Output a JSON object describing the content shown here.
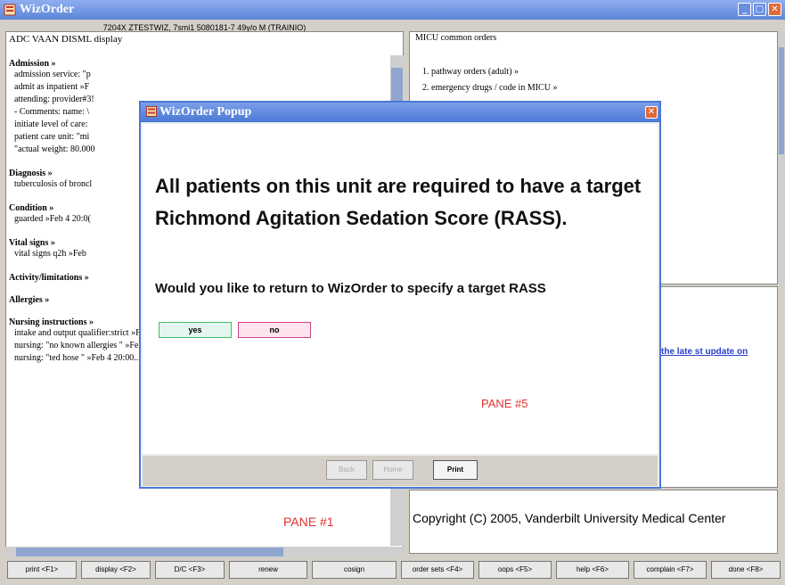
{
  "window": {
    "title": "WizOrder"
  },
  "left_pane": {
    "header": "7204X ZTESTWIZ, 7smi1 5080181-7 49y/o M (TRAINIO)",
    "title": "ADC VAAN DISML display",
    "sections": [
      {
        "head": "Admission »",
        "lines": [
          "admission service: \"p",
          "admit as inpatient »F",
          "attending: provider#3!",
          "- Comments: name: \\",
          "initiate level of care:",
          "patient care unit: \"mi",
          "\"actual weight: 80.000"
        ]
      },
      {
        "head": "Diagnosis »",
        "lines": [
          "tuberculosis of broncl"
        ]
      },
      {
        "head": "Condition »",
        "lines": [
          "guarded »Feb 4 20:0("
        ]
      },
      {
        "head": "Vital signs »",
        "lines": [
          "vital signs q2h »Feb"
        ]
      },
      {
        "head": "Activity/limitations »",
        "lines": []
      },
      {
        "head": "Allergies »",
        "lines": []
      },
      {
        "head": "Nursing instructions »",
        "lines": [
          "intake and output qualifier:strict »Feb 4 20:00...",
          "nursing: \"no known allergies \" »Feb 4 20:00...",
          "nursing: \"ted hose \" »Feb 4 20:00..."
        ]
      }
    ],
    "pane_label": "PANE #1"
  },
  "right_top": {
    "title": "MICU common orders",
    "items": [
      "1. pathway orders (adult) »",
      "2. emergency drugs / code in MICU »"
    ]
  },
  "right_mid": {
    "link": "the late st update on"
  },
  "right_bot": {
    "copyright": "Copyright (C) 2005, Vanderbilt University Medical Center"
  },
  "function_buttons": [
    "print <F1>",
    "display <F2>",
    "D/C <F3>",
    "renew",
    "cosign",
    "order sets <F4>",
    "oops <F5>",
    "help <F6>",
    "complain <F7>",
    "done <F8>"
  ],
  "popup": {
    "title": "WizOrder Popup",
    "message": "All patients on this unit are required to have a target Richmond Agitation Sedation Score (RASS).",
    "question": "Would you like to return to WizOrder to specify a target RASS",
    "yes_label": "yes",
    "no_label": "no",
    "pane_label": "PANE #5",
    "footer": {
      "back": "Back",
      "home": "Home",
      "print": "Print"
    }
  },
  "colors": {
    "titlebar": "#5b85d6",
    "pane_label": "#e03030",
    "link": "#2a3fc7"
  }
}
